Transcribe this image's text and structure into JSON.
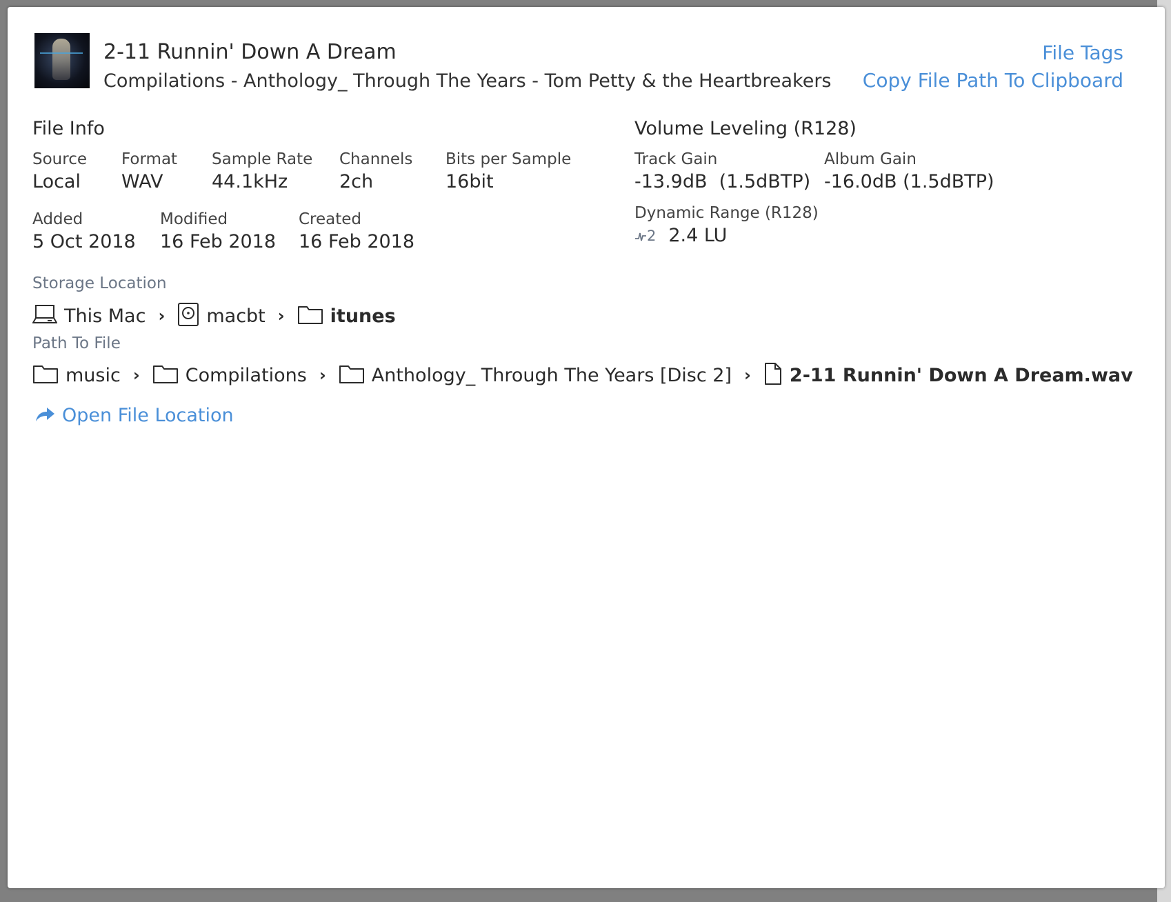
{
  "header": {
    "title": "2-11 Runnin' Down A Dream",
    "subtitle": "Compilations - Anthology_ Through The Years - Tom Petty & the Heartbreakers",
    "file_tags": "File Tags",
    "copy_path": "Copy File Path To Clipboard"
  },
  "file_info": {
    "heading": "File Info",
    "fields": [
      {
        "label": "Source",
        "value": "Local"
      },
      {
        "label": "Format",
        "value": "WAV"
      },
      {
        "label": "Sample Rate",
        "value": "44.1kHz"
      },
      {
        "label": "Channels",
        "value": "2ch"
      },
      {
        "label": "Bits per Sample",
        "value": "16bit"
      }
    ],
    "dates": [
      {
        "label": "Added",
        "value": "5 Oct 2018"
      },
      {
        "label": "Modified",
        "value": "16 Feb 2018"
      },
      {
        "label": "Created",
        "value": "16 Feb 2018"
      }
    ]
  },
  "volume": {
    "heading": "Volume Leveling (R128)",
    "track_gain_label": "Track Gain",
    "track_gain_value": "-13.9dB  (1.5dBTP)",
    "album_gain_label": "Album Gain",
    "album_gain_value": "-16.0dB (1.5dBTP)",
    "dr_label": "Dynamic Range (R128)",
    "dr_icon_text": "2",
    "dr_value": "2.4 LU"
  },
  "storage": {
    "heading": "Storage Location",
    "items": [
      "This Mac",
      "macbt",
      "itunes"
    ]
  },
  "path": {
    "heading": "Path To File",
    "items": [
      "music",
      "Compilations",
      "Anthology_ Through The Years [Disc 2]",
      "2-11 Runnin' Down A Dream.wav"
    ]
  },
  "open_location": "Open File Location",
  "colors": {
    "accent": "#4a8fd8",
    "muted": "#6b7686"
  }
}
